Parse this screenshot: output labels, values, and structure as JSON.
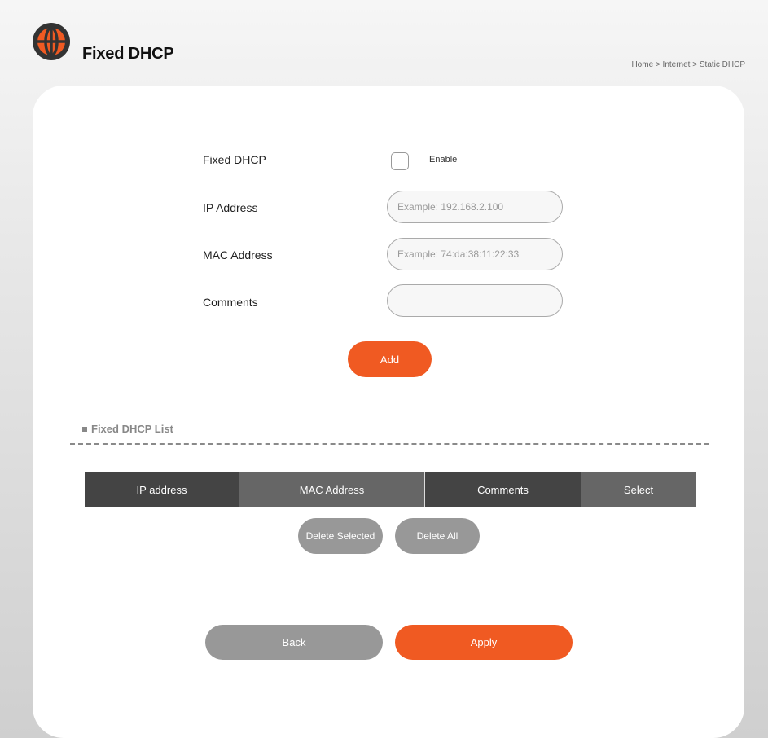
{
  "header": {
    "title": "Fixed DHCP",
    "breadcrumb": {
      "home": "Home",
      "sep1": " > ",
      "internet": "Internet",
      "sep2": " > ",
      "current": "Static DHCP"
    }
  },
  "form": {
    "fixed_dhcp_label": "Fixed DHCP",
    "enable_label": "Enable",
    "enable_checked": false,
    "ip_label": "IP Address",
    "ip_placeholder": "Example: 192.168.2.100",
    "ip_value": "",
    "mac_label": "MAC Address",
    "mac_placeholder": "Example: 74:da:38:11:22:33",
    "mac_value": "",
    "comments_label": "Comments",
    "comments_value": "",
    "add_label": "Add"
  },
  "list": {
    "title": "Fixed DHCP List",
    "columns": [
      "IP address",
      "MAC Address",
      "Comments",
      "Select"
    ],
    "rows": [],
    "delete_selected_label": "Delete Selected",
    "delete_all_label": "Delete All"
  },
  "footer": {
    "back_label": "Back",
    "apply_label": "Apply"
  },
  "colors": {
    "accent": "#f05a22",
    "button_gray": "#989898",
    "header_dark": "#444444",
    "header_mid": "#666666"
  }
}
